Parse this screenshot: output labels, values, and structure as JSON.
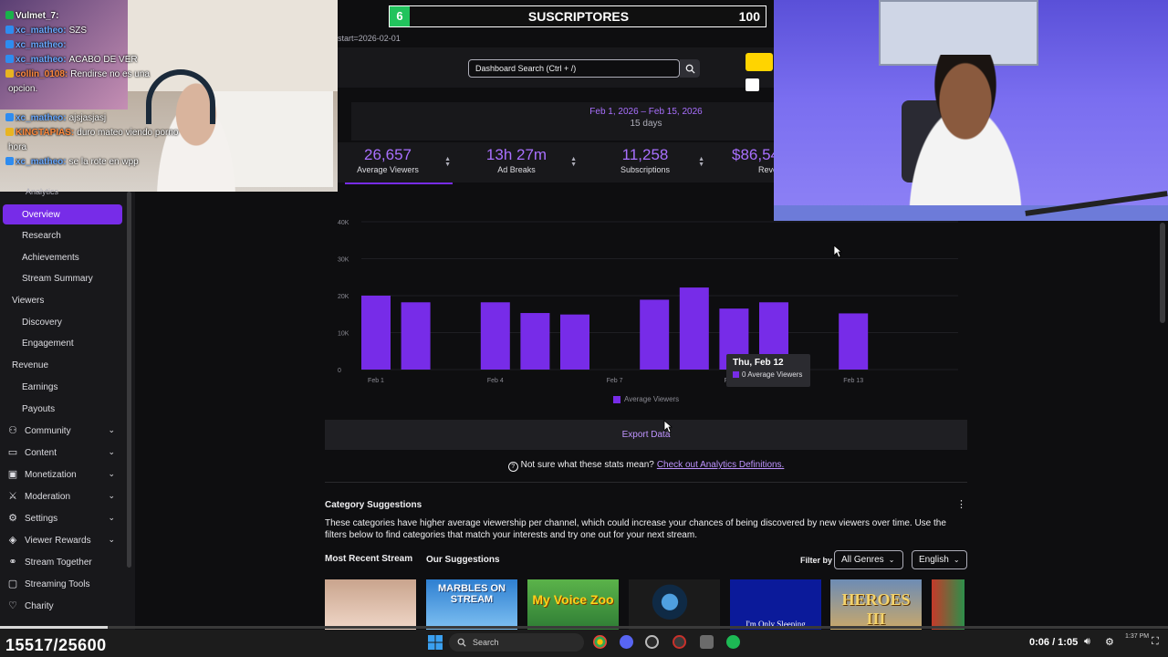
{
  "overlay": {
    "subs_current": "6",
    "subs_label": "SUSCRIPTORES",
    "subs_goal": "100",
    "counter": "15517/25600"
  },
  "chat": [
    {
      "user": "Vulmet_7:",
      "msg": "",
      "color": "#ffffff",
      "badge": "g"
    },
    {
      "user": "xc_matheo:",
      "msg": "SZS",
      "color": "#6aa9ff",
      "badge": "b"
    },
    {
      "user": "xc_matheo:",
      "msg": "",
      "color": "#6aa9ff",
      "badge": "b"
    },
    {
      "user": "xc_matheo:",
      "msg": "ACABO DE VER",
      "color": "#6aa9ff",
      "badge": "b"
    },
    {
      "user": "collin_0108:",
      "msg": "Rendirse no es una",
      "color": "#ff8a3d",
      "badge": "y"
    },
    {
      "user": "",
      "msg": "opcion.",
      "color": "#ffffff",
      "badge": ""
    },
    {
      "user": "",
      "msg": "",
      "color": "#ffffff",
      "badge": ""
    },
    {
      "user": "xc_matheo:",
      "msg": "ajsjasjasj",
      "color": "#6aa9ff",
      "badge": "b"
    },
    {
      "user": "KINGTAPIAS:",
      "msg": "duro mateo viendo porno",
      "color": "#ff8a3d",
      "badge": "y"
    },
    {
      "user": "",
      "msg": "hora",
      "color": "#ffffff",
      "badge": ""
    },
    {
      "user": "xc_matheo:",
      "msg": "se la rote en wpp",
      "color": "#6aa9ff",
      "badge": "b"
    }
  ],
  "page": {
    "url_fragment": "start=2026-02-01",
    "search_placeholder": "Dashboard Search (Ctrl + /)",
    "date_range": "Feb 1, 2026 – Feb 15, 2026",
    "date_days": "15 days",
    "analytics_label": "Analytics"
  },
  "metrics": [
    {
      "value": "26,657",
      "label": "Average Viewers"
    },
    {
      "value": "13h 27m",
      "label": "Ad Breaks"
    },
    {
      "value": "11,258",
      "label": "Subscriptions"
    },
    {
      "value": "$86,54",
      "label": "Reve"
    }
  ],
  "sidebar": {
    "items": [
      {
        "label": "Overview",
        "kind": "active",
        "top": 224
      },
      {
        "label": "Research",
        "kind": "sub",
        "top": 247
      },
      {
        "label": "Achievements",
        "kind": "sub",
        "top": 271
      },
      {
        "label": "Stream Summary",
        "kind": "sub",
        "top": 294
      },
      {
        "label": "Viewers",
        "kind": "top",
        "top": 318
      },
      {
        "label": "Discovery",
        "kind": "sub",
        "top": 342
      },
      {
        "label": "Engagement",
        "kind": "sub",
        "top": 365
      },
      {
        "label": "Revenue",
        "kind": "top",
        "top": 389
      },
      {
        "label": "Earnings",
        "kind": "sub",
        "top": 413
      },
      {
        "label": "Payouts",
        "kind": "sub",
        "top": 437
      },
      {
        "label": "Community",
        "kind": "icon",
        "icon": "people-icon",
        "glyph": "⚇",
        "chev": true,
        "top": 461
      },
      {
        "label": "Content",
        "kind": "icon",
        "icon": "content-icon",
        "glyph": "▭",
        "chev": true,
        "top": 485
      },
      {
        "label": "Monetization",
        "kind": "icon",
        "icon": "monetization-icon",
        "glyph": "▣",
        "chev": true,
        "top": 509
      },
      {
        "label": "Moderation",
        "kind": "icon",
        "icon": "sword-icon",
        "glyph": "⚔",
        "chev": true,
        "top": 533
      },
      {
        "label": "Settings",
        "kind": "icon",
        "icon": "gear-icon",
        "glyph": "⚙",
        "chev": true,
        "top": 557
      },
      {
        "label": "Viewer Rewards",
        "kind": "icon",
        "icon": "reward-icon",
        "glyph": "◈",
        "chev": true,
        "top": 581
      },
      {
        "label": "Stream Together",
        "kind": "icon",
        "icon": "stream-together-icon",
        "glyph": "⚭",
        "chev": false,
        "top": 605
      },
      {
        "label": "Streaming Tools",
        "kind": "icon",
        "icon": "tools-icon",
        "glyph": "▢",
        "chev": false,
        "top": 629
      },
      {
        "label": "Charity",
        "kind": "icon",
        "icon": "charity-icon",
        "glyph": "♡",
        "chev": false,
        "top": 653
      }
    ]
  },
  "chart_data": {
    "type": "bar",
    "categories": [
      "Feb 1",
      "Feb 2",
      "Feb 3",
      "Feb 4",
      "Feb 5",
      "Feb 6",
      "Feb 7",
      "Feb 8",
      "Feb 9",
      "Feb 10",
      "Feb 11",
      "Feb 12",
      "Feb 13",
      "Feb 14",
      "Feb 15"
    ],
    "values": [
      20000,
      18200,
      0,
      18200,
      15300,
      14900,
      0,
      18900,
      22200,
      16500,
      18200,
      0,
      15200,
      0,
      0
    ],
    "tick_labels_x": [
      "Feb 1",
      "",
      "",
      "Feb 4",
      "",
      "",
      "Feb 7",
      "",
      "",
      "Feb 10",
      "",
      "",
      "Feb 13",
      "",
      ""
    ],
    "yticks": [
      "0",
      "10K",
      "20K",
      "30K",
      "40K"
    ],
    "ylim": [
      0,
      40000
    ],
    "legend": "Average Viewers",
    "tooltip_title": "Thu, Feb 12",
    "tooltip_row": "0 Average Viewers",
    "grid": true,
    "bar_color": "#772ce8"
  },
  "actions": {
    "export": "Export Data",
    "help_question": "Not sure what these stats mean?",
    "help_link": "Check out Analytics Definitions."
  },
  "categories": {
    "title": "Category Suggestions",
    "desc": "These categories have higher average viewership per channel, which could increase your chances of being discovered by new viewers over time. Use the filters below to find categories that match your interests and try one out for your next stream.",
    "tab_recent": "Most Recent Stream",
    "tab_suggestions": "Our Suggestions",
    "filter_label": "Filter by",
    "genre": "All Genres",
    "language": "English",
    "thumbs": [
      "",
      "MARBLES ON STREAM",
      "My Voice Zoo",
      "",
      "I'm Only Sleeping",
      "HEROES III",
      ""
    ]
  },
  "taskbar": {
    "search": "Search",
    "time": "0:06 / 1:05",
    "clock": "1:37 PM"
  }
}
